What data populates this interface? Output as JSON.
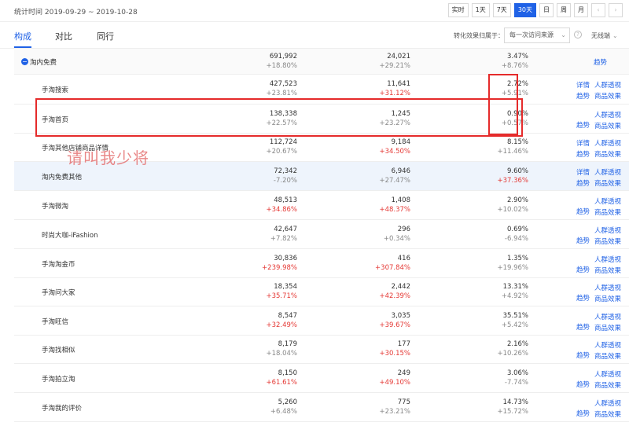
{
  "header": {
    "period": "统计时间 2019-09-29 ~ 2019-10-28",
    "range_buttons": [
      "实时",
      "1天",
      "7天",
      "30天",
      "日",
      "周",
      "月"
    ],
    "active_range": "30天",
    "prev_arrow": "‹",
    "next_arrow": "›"
  },
  "tabs": [
    "构成",
    "对比",
    "同行"
  ],
  "attribution": {
    "label": "转化效果归属于：",
    "select_value": "每一次访问来源",
    "help": "?",
    "mode": "无线端"
  },
  "rows": [
    {
      "name": "淘内免费",
      "v1": "691,992",
      "c1": "+18.80%",
      "c1_red": false,
      "v2": "24,021",
      "c2": "+29.21%",
      "c2_red": false,
      "v3": "3.47%",
      "c3": "+8.76%",
      "c3_red": false,
      "links": [
        "趋势"
      ]
    },
    {
      "name": "手淘搜索",
      "v1": "427,523",
      "c1": "+23.81%",
      "c1_red": false,
      "v2": "11,641",
      "c2": "+31.12%",
      "c2_red": true,
      "v3": "2.72%",
      "c3": "+5.91%",
      "c3_red": false,
      "links": [
        "详情",
        "人群透视",
        "趋势",
        "商品效果"
      ]
    },
    {
      "name": "手淘首页",
      "v1": "138,338",
      "c1": "+22.57%",
      "c1_red": false,
      "v2": "1,245",
      "c2": "+23.27%",
      "c2_red": false,
      "v3": "0.90%",
      "c3": "+0.57%",
      "c3_red": false,
      "links": [
        "人群透视",
        "趋势",
        "商品效果"
      ]
    },
    {
      "name": "手淘其他店铺商品详情",
      "v1": "112,724",
      "c1": "+20.67%",
      "c1_red": false,
      "v2": "9,184",
      "c2": "+34.50%",
      "c2_red": true,
      "v3": "8.15%",
      "c3": "+11.46%",
      "c3_red": false,
      "links": [
        "详情",
        "人群透视",
        "趋势",
        "商品效果"
      ]
    },
    {
      "name": "淘内免费其他",
      "v1": "72,342",
      "c1": "-7.20%",
      "c1_red": false,
      "v2": "6,946",
      "c2": "+27.47%",
      "c2_red": false,
      "v3": "9.60%",
      "c3": "+37.36%",
      "c3_red": true,
      "links": [
        "详情",
        "人群透视",
        "趋势",
        "商品效果"
      ]
    },
    {
      "name": "手淘微淘",
      "v1": "48,513",
      "c1": "+34.86%",
      "c1_red": true,
      "v2": "1,408",
      "c2": "+48.37%",
      "c2_red": true,
      "v3": "2.90%",
      "c3": "+10.02%",
      "c3_red": false,
      "links": [
        "人群透视",
        "趋势",
        "商品效果"
      ]
    },
    {
      "name": "时尚大咖-iFashion",
      "v1": "42,647",
      "c1": "+7.82%",
      "c1_red": false,
      "v2": "296",
      "c2": "+0.34%",
      "c2_red": false,
      "v3": "0.69%",
      "c3": "-6.94%",
      "c3_red": false,
      "links": [
        "人群透视",
        "趋势",
        "商品效果"
      ]
    },
    {
      "name": "手淘淘金币",
      "v1": "30,836",
      "c1": "+239.98%",
      "c1_red": true,
      "v2": "416",
      "c2": "+307.84%",
      "c2_red": true,
      "v3": "1.35%",
      "c3": "+19.96%",
      "c3_red": false,
      "links": [
        "人群透视",
        "趋势",
        "商品效果"
      ]
    },
    {
      "name": "手淘问大家",
      "v1": "18,354",
      "c1": "+35.71%",
      "c1_red": true,
      "v2": "2,442",
      "c2": "+42.39%",
      "c2_red": true,
      "v3": "13.31%",
      "c3": "+4.92%",
      "c3_red": false,
      "links": [
        "人群透视",
        "趋势",
        "商品效果"
      ]
    },
    {
      "name": "手淘旺信",
      "v1": "8,547",
      "c1": "+32.49%",
      "c1_red": true,
      "v2": "3,035",
      "c2": "+39.67%",
      "c2_red": true,
      "v3": "35.51%",
      "c3": "+5.42%",
      "c3_red": false,
      "links": [
        "人群透视",
        "趋势",
        "商品效果"
      ]
    },
    {
      "name": "手淘找相似",
      "v1": "8,179",
      "c1": "+18.04%",
      "c1_red": false,
      "v2": "177",
      "c2": "+30.15%",
      "c2_red": true,
      "v3": "2.16%",
      "c3": "+10.26%",
      "c3_red": false,
      "links": [
        "人群透视",
        "趋势",
        "商品效果"
      ]
    },
    {
      "name": "手淘拍立淘",
      "v1": "8,150",
      "c1": "+61.61%",
      "c1_red": true,
      "v2": "249",
      "c2": "+49.10%",
      "c2_red": true,
      "v3": "3.06%",
      "c3": "-7.74%",
      "c3_red": false,
      "links": [
        "人群透视",
        "趋势",
        "商品效果"
      ]
    },
    {
      "name": "手淘我的评价",
      "v1": "5,260",
      "c1": "+6.48%",
      "c1_red": false,
      "v2": "775",
      "c2": "+23.21%",
      "c2_red": false,
      "v3": "14.73%",
      "c3": "+15.72%",
      "c3_red": false,
      "links": [
        "人群透视",
        "趋势",
        "商品效果"
      ]
    }
  ],
  "watermark": "请叫我少将",
  "colors": {
    "accent": "#2062e6",
    "red": "#e53935",
    "annotation": "#e52b2b"
  }
}
